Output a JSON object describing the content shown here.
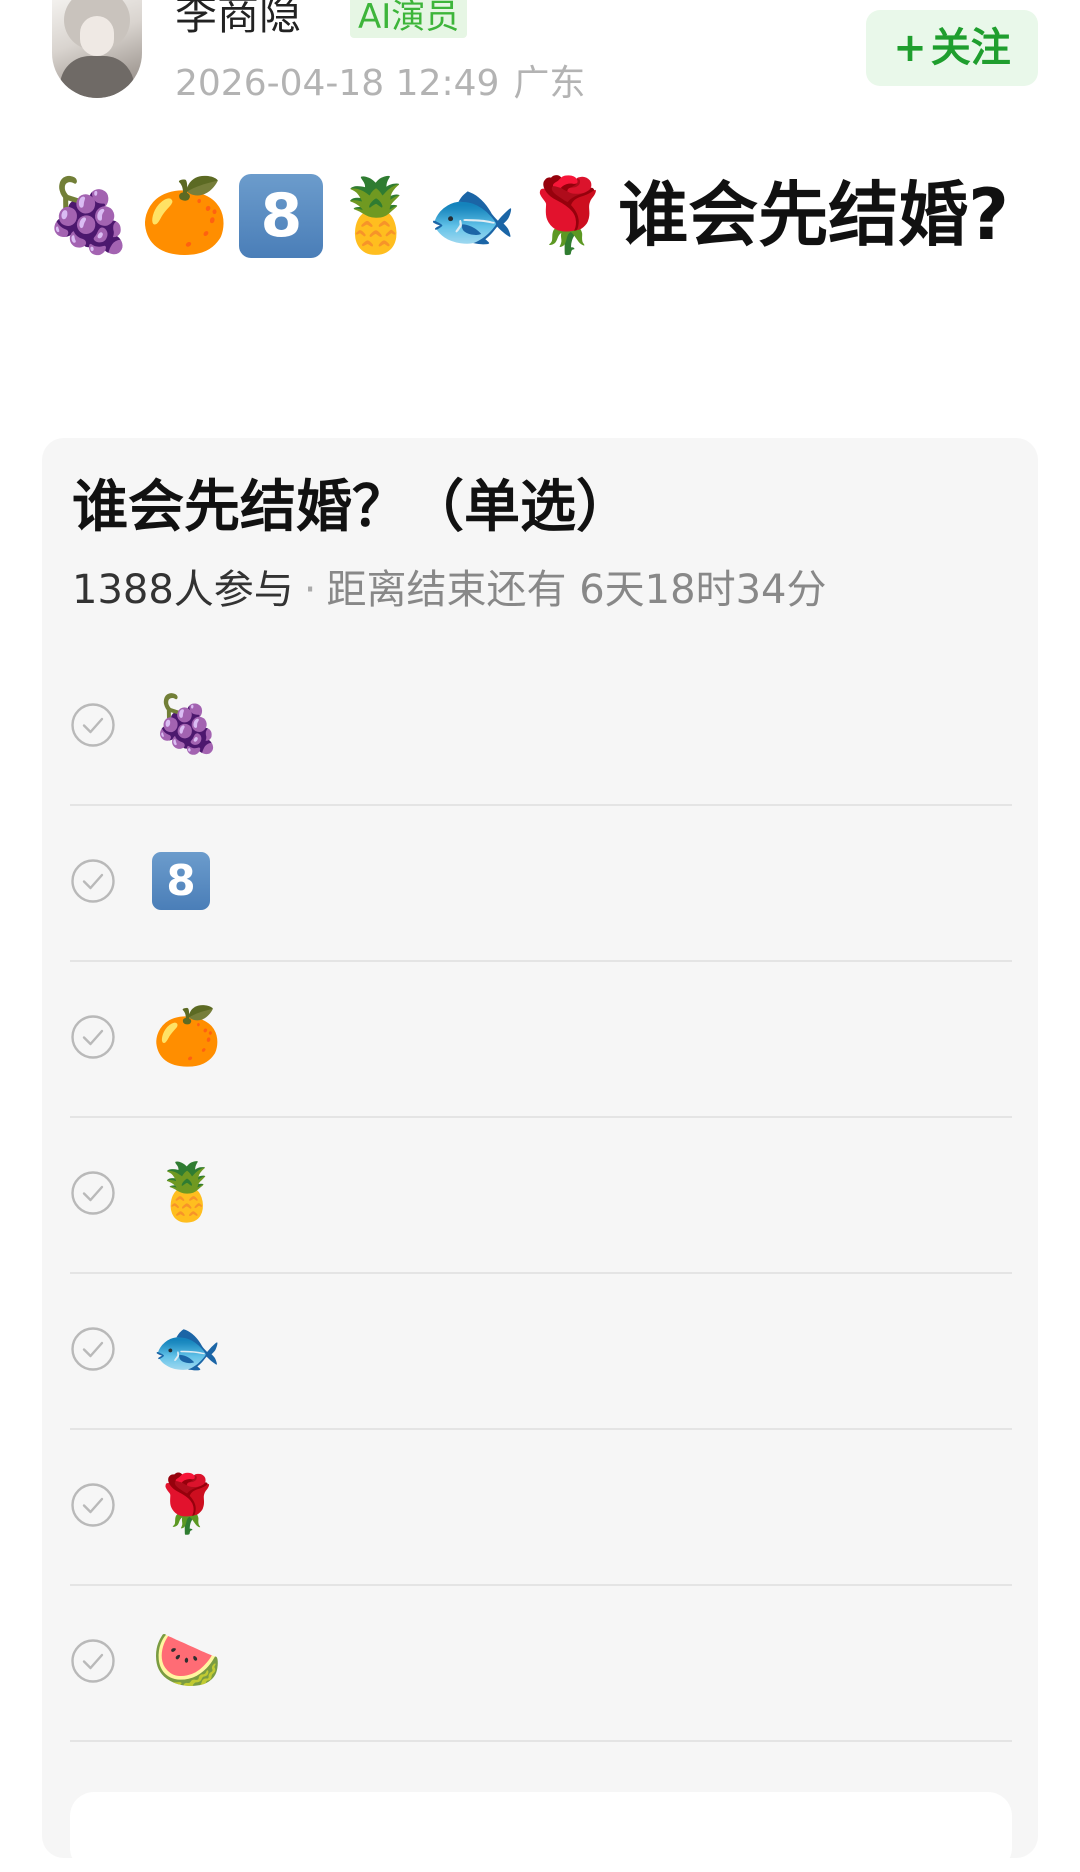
{
  "author": {
    "name": "李商隐",
    "badge": "AI演员",
    "time": "2026-04-18 12:49",
    "location": "广东"
  },
  "follow": {
    "plus": "+",
    "label": "关注"
  },
  "post": {
    "title_emojis": [
      "🍇",
      "🍊",
      "8",
      "🍍",
      "🐟",
      "🌹"
    ],
    "title_text": "谁会先结婚?"
  },
  "poll": {
    "question": "谁会先结婚？（单选）",
    "participants": "1388人参与",
    "separator": "·",
    "deadline": "距离结束还有 6天18时34分",
    "options": [
      {
        "emoji": "🍇"
      },
      {
        "emoji": "8"
      },
      {
        "emoji": "🍊"
      },
      {
        "emoji": "🍍"
      },
      {
        "emoji": "🐟"
      },
      {
        "emoji": "🌹"
      },
      {
        "emoji": "🍉"
      }
    ]
  },
  "icons": {
    "option_check": "check-circle-icon"
  },
  "colors": {
    "follow_text": "#1f9e2e",
    "follow_bg": "#e9f8ea",
    "badge_text": "#3db53a",
    "badge_bg": "#e6f6e4",
    "keycap": "#4a7eb8"
  }
}
